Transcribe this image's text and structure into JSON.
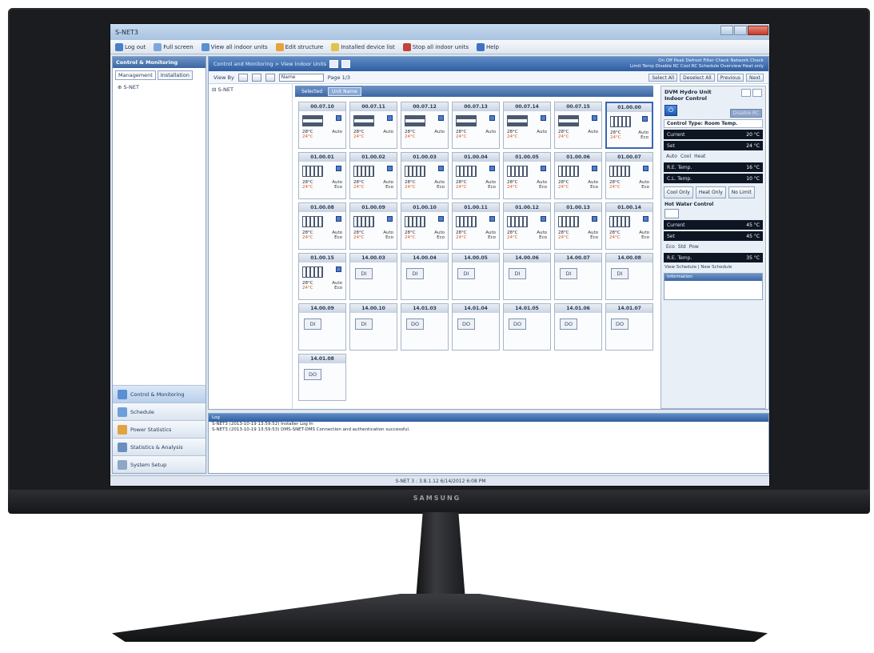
{
  "window": {
    "title": "S-NET3"
  },
  "toolbar": [
    {
      "label": "Log out",
      "color": "#4a7fc8"
    },
    {
      "label": "Full screen",
      "color": "#7ea6dc"
    },
    {
      "label": "View all indoor units",
      "color": "#5a8fd2"
    },
    {
      "label": "Edit structure",
      "color": "#e8a23c"
    },
    {
      "label": "Installed device list",
      "color": "#e4c14a"
    },
    {
      "label": "Stop all indoor units",
      "color": "#c0443a"
    },
    {
      "label": "Help",
      "color": "#3d72c4"
    }
  ],
  "left": {
    "header": "Control & Monitoring",
    "tabs": [
      "Management",
      "Installation"
    ],
    "tree_root": "S-NET",
    "nav": [
      {
        "label": "Control & Monitoring",
        "color": "#5a8fd2",
        "active": true
      },
      {
        "label": "Schedule",
        "color": "#6f9fd8",
        "active": false
      },
      {
        "label": "Power Statistics",
        "color": "#e0a340",
        "active": false
      },
      {
        "label": "Statistics & Analysis",
        "color": "#6a8fbf",
        "active": false
      },
      {
        "label": "System Setup",
        "color": "#8fa6c4",
        "active": false
      }
    ]
  },
  "main": {
    "breadcrumb": "Control and Monitoring > View Indoor Units",
    "legend_line1": "On  Off  Peak  Defrost  Filter  Check  Network Check",
    "legend_line2": "Limit Temp  Disable RC  Cool RC  Schedule  Overview  Heat only",
    "viewby_label": "View By",
    "sort_value": "Name",
    "page_label": "Page 1/3",
    "right_buttons": [
      "Select All",
      "Deselect All",
      "Previous",
      "Next"
    ],
    "tree_item": "S-NET",
    "select_tabs": [
      "Selected",
      "Unit Name"
    ]
  },
  "units": [
    {
      "id": "00.07.10",
      "kind": "ac",
      "icon": "flat",
      "t1": "28°C",
      "t2": "24°C",
      "mode": "Auto",
      "mode2": "",
      "selected": false
    },
    {
      "id": "00.07.11",
      "kind": "ac",
      "icon": "flat",
      "t1": "28°C",
      "t2": "24°C",
      "mode": "Auto",
      "mode2": "",
      "selected": false
    },
    {
      "id": "00.07.12",
      "kind": "ac",
      "icon": "flat",
      "t1": "28°C",
      "t2": "24°C",
      "mode": "Auto",
      "mode2": "",
      "selected": false
    },
    {
      "id": "00.07.13",
      "kind": "ac",
      "icon": "flat",
      "t1": "28°C",
      "t2": "24°C",
      "mode": "Auto",
      "mode2": "",
      "selected": false
    },
    {
      "id": "00.07.14",
      "kind": "ac",
      "icon": "flat",
      "t1": "28°C",
      "t2": "24°C",
      "mode": "Auto",
      "mode2": "",
      "selected": false
    },
    {
      "id": "00.07.15",
      "kind": "ac",
      "icon": "flat",
      "t1": "28°C",
      "t2": "24°C",
      "mode": "Auto",
      "mode2": "",
      "selected": false
    },
    {
      "id": "01.00.00",
      "kind": "ac",
      "icon": "hydro",
      "t1": "28°C",
      "t2": "24°C",
      "mode": "Auto",
      "mode2": "Eco",
      "selected": true
    },
    {
      "id": "01.00.01",
      "kind": "ac",
      "icon": "hydro",
      "t1": "28°C",
      "t2": "24°C",
      "mode": "Auto",
      "mode2": "Eco",
      "selected": false
    },
    {
      "id": "01.00.02",
      "kind": "ac",
      "icon": "hydro",
      "t1": "28°C",
      "t2": "24°C",
      "mode": "Auto",
      "mode2": "Eco",
      "selected": false
    },
    {
      "id": "01.00.03",
      "kind": "ac",
      "icon": "hydro",
      "t1": "28°C",
      "t2": "24°C",
      "mode": "Auto",
      "mode2": "Eco",
      "selected": false
    },
    {
      "id": "01.00.04",
      "kind": "ac",
      "icon": "hydro",
      "t1": "28°C",
      "t2": "24°C",
      "mode": "Auto",
      "mode2": "Eco",
      "selected": false
    },
    {
      "id": "01.00.05",
      "kind": "ac",
      "icon": "hydro",
      "t1": "28°C",
      "t2": "24°C",
      "mode": "Auto",
      "mode2": "Eco",
      "selected": false
    },
    {
      "id": "01.00.06",
      "kind": "ac",
      "icon": "hydro",
      "t1": "28°C",
      "t2": "24°C",
      "mode": "Auto",
      "mode2": "Eco",
      "selected": false
    },
    {
      "id": "01.00.07",
      "kind": "ac",
      "icon": "hydro",
      "t1": "28°C",
      "t2": "24°C",
      "mode": "Auto",
      "mode2": "Eco",
      "selected": false
    },
    {
      "id": "01.00.08",
      "kind": "ac",
      "icon": "hydro",
      "t1": "28°C",
      "t2": "24°C",
      "mode": "Auto",
      "mode2": "Eco",
      "selected": false
    },
    {
      "id": "01.00.09",
      "kind": "ac",
      "icon": "hydro",
      "t1": "28°C",
      "t2": "24°C",
      "mode": "Auto",
      "mode2": "Eco",
      "selected": false
    },
    {
      "id": "01.00.10",
      "kind": "ac",
      "icon": "hydro",
      "t1": "28°C",
      "t2": "24°C",
      "mode": "Auto",
      "mode2": "Eco",
      "selected": false
    },
    {
      "id": "01.00.11",
      "kind": "ac",
      "icon": "hydro",
      "t1": "28°C",
      "t2": "24°C",
      "mode": "Auto",
      "mode2": "Eco",
      "selected": false
    },
    {
      "id": "01.00.12",
      "kind": "ac",
      "icon": "hydro",
      "t1": "28°C",
      "t2": "24°C",
      "mode": "Auto",
      "mode2": "Eco",
      "selected": false
    },
    {
      "id": "01.00.13",
      "kind": "ac",
      "icon": "hydro",
      "t1": "28°C",
      "t2": "24°C",
      "mode": "Auto",
      "mode2": "Eco",
      "selected": false
    },
    {
      "id": "01.00.14",
      "kind": "ac",
      "icon": "hydro",
      "t1": "28°C",
      "t2": "24°C",
      "mode": "Auto",
      "mode2": "Eco",
      "selected": false
    },
    {
      "id": "01.00.15",
      "kind": "ac",
      "icon": "hydro",
      "t1": "28°C",
      "t2": "24°C",
      "mode": "Auto",
      "mode2": "Eco",
      "selected": false
    },
    {
      "id": "14.00.03",
      "kind": "io",
      "label": "DI",
      "selected": false
    },
    {
      "id": "14.00.04",
      "kind": "io",
      "label": "DI",
      "selected": false
    },
    {
      "id": "14.00.05",
      "kind": "io",
      "label": "DI",
      "selected": false
    },
    {
      "id": "14.00.06",
      "kind": "io",
      "label": "DI",
      "selected": false
    },
    {
      "id": "14.00.07",
      "kind": "io",
      "label": "DI",
      "selected": false
    },
    {
      "id": "14.00.08",
      "kind": "io",
      "label": "DI",
      "selected": false
    },
    {
      "id": "14.00.09",
      "kind": "io",
      "label": "DI",
      "selected": false
    },
    {
      "id": "14.00.10",
      "kind": "io",
      "label": "DI",
      "selected": false
    },
    {
      "id": "14.01.03",
      "kind": "io",
      "label": "DO",
      "selected": false
    },
    {
      "id": "14.01.04",
      "kind": "io",
      "label": "DO",
      "selected": false
    },
    {
      "id": "14.01.05",
      "kind": "io",
      "label": "DO",
      "selected": false
    },
    {
      "id": "14.01.06",
      "kind": "io",
      "label": "DO",
      "selected": false
    },
    {
      "id": "14.01.07",
      "kind": "io",
      "label": "DO",
      "selected": false
    },
    {
      "id": "14.01.08",
      "kind": "io",
      "label": "DO",
      "selected": false
    }
  ],
  "panel": {
    "title": "DVM Hydro Unit",
    "subtitle": "Indoor Control",
    "power": "⏻",
    "disable_rc": "Disable RC",
    "control_type": "Control Type: Room Temp.",
    "current_label": "Current",
    "current_value": "20 °C",
    "set_label": "Set",
    "set_value": "24 °C",
    "modes": [
      "Auto",
      "Cool",
      "Heat"
    ],
    "range1_label": "R.E. Temp.",
    "range1_value": "16 °C",
    "range2_label": "C.L. Temp.",
    "range2_value": "10 °C",
    "op_buttons": [
      "Cool Only",
      "Heat Only",
      "No Limit"
    ],
    "hot_water_title": "Hot Water Control",
    "hw_current_label": "Current",
    "hw_current_value": "45 °C",
    "hw_set_label": "Set",
    "hw_set_value": "45 °C",
    "hw_modes": [
      "Eco",
      "Std",
      "Pow"
    ],
    "hw_range_label": "R.E. Temp.",
    "hw_range_value": "35 °C",
    "links": "View Schedule | New Schedule",
    "info_header": "Information"
  },
  "log": {
    "header": "Log",
    "lines": [
      "S-NET3 (2013-10-19 13:59:52) Installer Log In",
      "S-NET3 (2013-10-19 13:59:53) DMS-SNET-DMS Connection and authentication successful."
    ]
  },
  "status": "S-NET 3 : 3.8.1.12  6/14/2012  6:08 PM",
  "brand": "SAMSUNG"
}
